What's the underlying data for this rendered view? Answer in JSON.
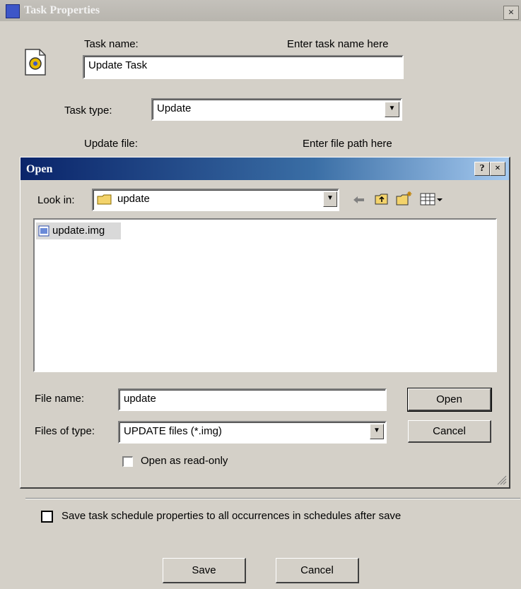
{
  "window": {
    "title": "Task Properties",
    "close": "×"
  },
  "task": {
    "name_label": "Task name:",
    "name_hint": "Enter task name here",
    "name_value": "Update Task",
    "type_label": "Task type:",
    "type_value": "Update",
    "file_label": "Update file:",
    "file_hint": "Enter file path here"
  },
  "open_dialog": {
    "title": "Open",
    "help": "?",
    "close": "×",
    "look_in_label": "Look in:",
    "look_in_value": "update",
    "files": [
      {
        "name": "update.img"
      }
    ],
    "file_name_label": "File name:",
    "file_name_value": "update",
    "file_type_label": "Files of type:",
    "file_type_value": "UPDATE files (*.img)",
    "open_button": "Open",
    "cancel_button": "Cancel",
    "read_only_label": "Open as read-only"
  },
  "save_all": {
    "label": "Save task schedule properties to all occurrences in schedules after save"
  },
  "footer": {
    "save_button": "Save",
    "cancel_button": "Cancel"
  }
}
